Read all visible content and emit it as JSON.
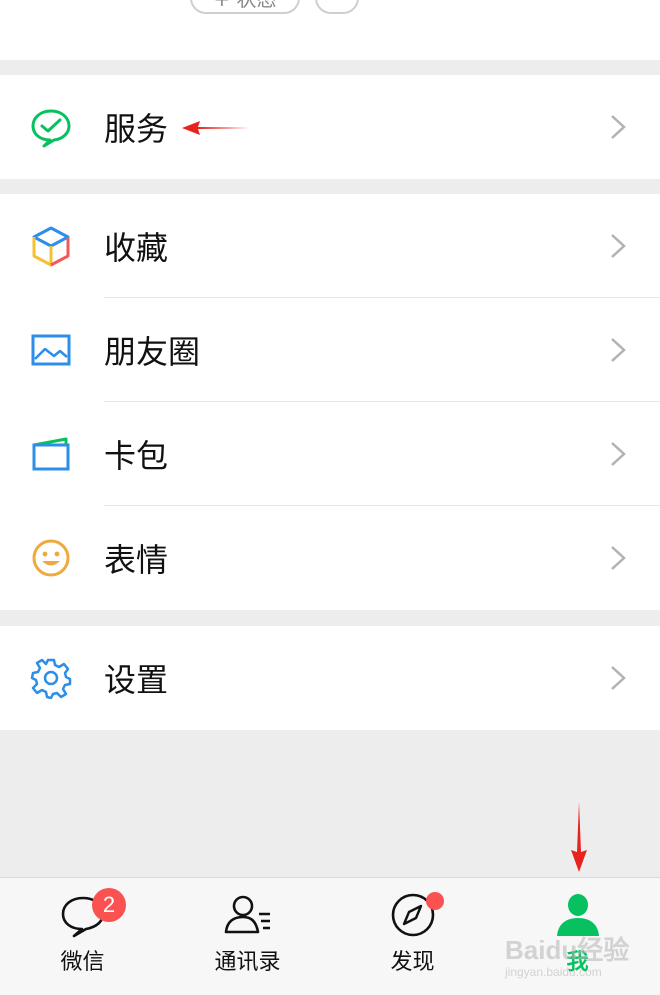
{
  "header": {
    "status_button": "+ 状态"
  },
  "menu": {
    "services": "服务",
    "favorites": "收藏",
    "moments": "朋友圈",
    "cards": "卡包",
    "stickers": "表情",
    "settings": "设置"
  },
  "tabbar": {
    "tabs": [
      {
        "label": "微信",
        "badge": "2"
      },
      {
        "label": "通讯录"
      },
      {
        "label": "发现"
      },
      {
        "label": "我"
      }
    ]
  },
  "watermark": {
    "text": "Baidu经验",
    "sub": "jingyan.baidu.com"
  },
  "colors": {
    "accent": "#07c160",
    "badge": "#fa5151",
    "annotation": "#e8231d"
  }
}
